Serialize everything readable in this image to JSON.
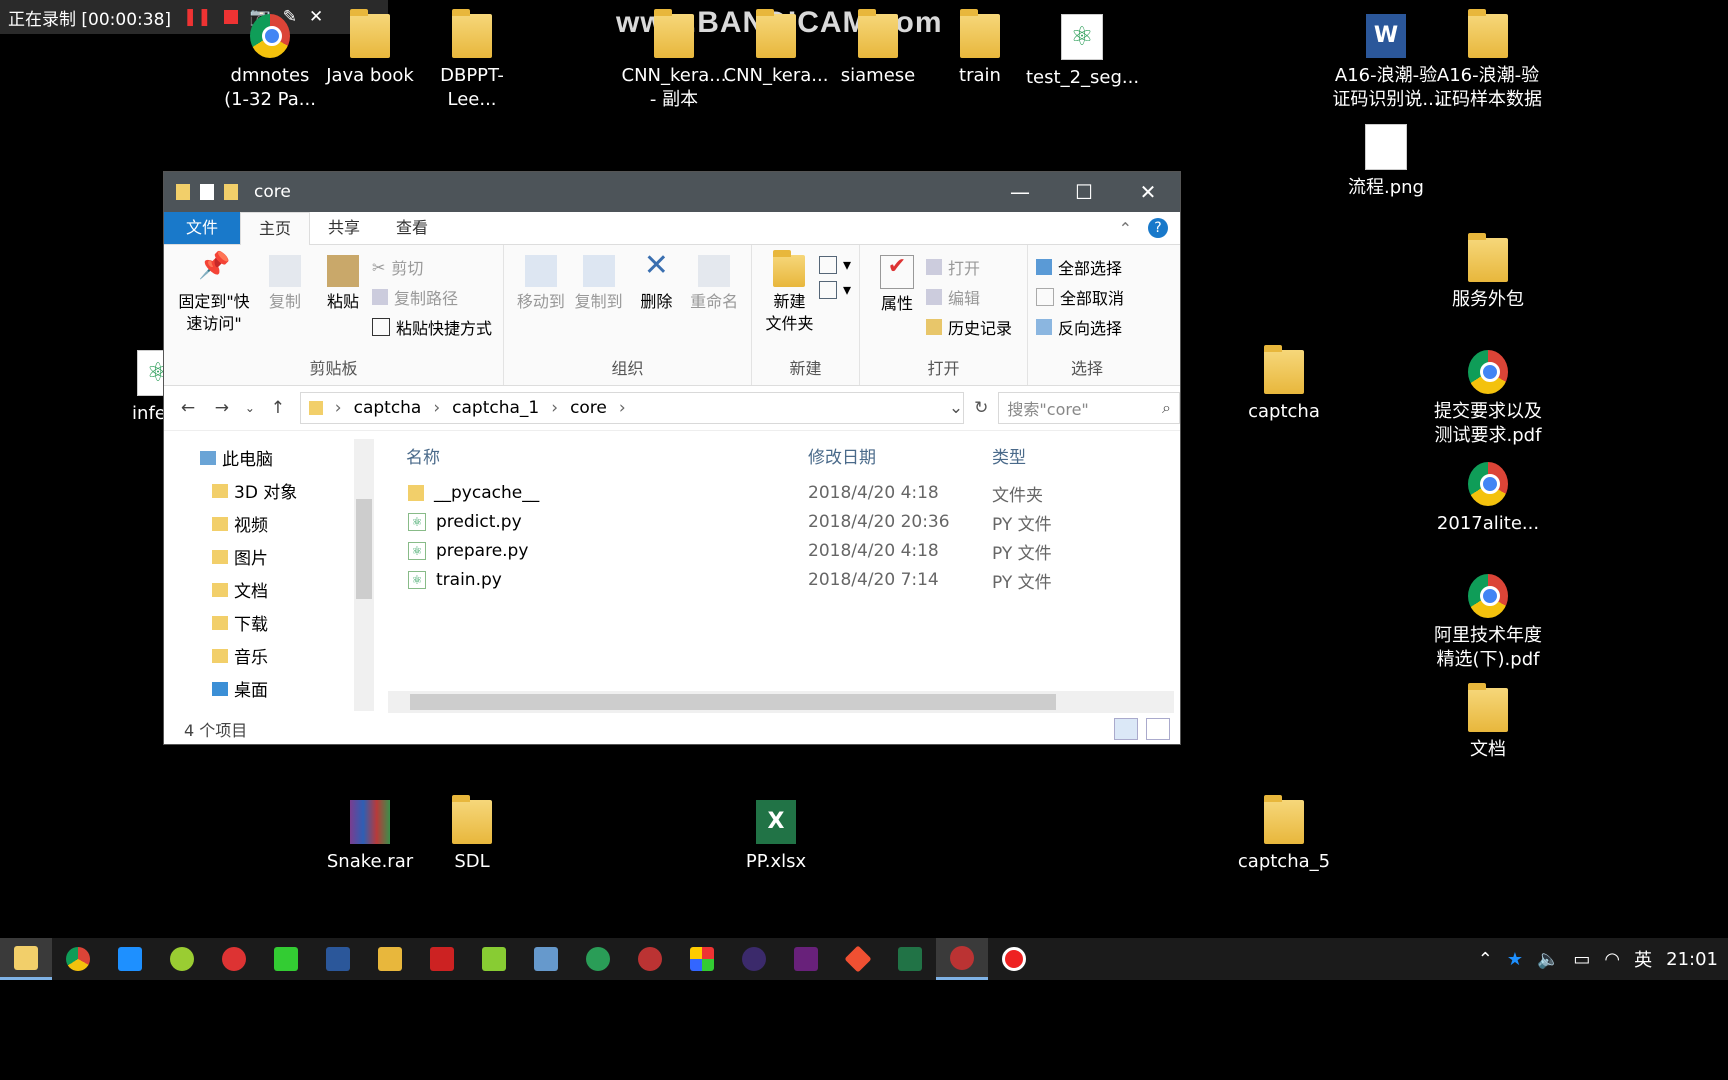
{
  "recorder": {
    "status": "正在录制 [00:00:38]"
  },
  "watermark": "www.BANDICAM.com",
  "desktop_icons": [
    {
      "label": "dmnotes\n(1-32 Pa...",
      "x": "",
      "type": "chrome"
    },
    {
      "label": "Java book"
    },
    {
      "label": "DBPPT-Lee..."
    },
    {
      "label": "CNN_kera...\n- 副本"
    },
    {
      "label": "CNN_kera..."
    },
    {
      "label": "siamese"
    },
    {
      "label": "train"
    },
    {
      "label": "test_2_seg..."
    },
    {
      "label": "A16-浪潮-验\n证码识别说..."
    },
    {
      "label": "A16-浪潮-验\n证码样本数据"
    },
    {
      "label": "流程.png"
    },
    {
      "label": "服务外包"
    },
    {
      "label": "captcha"
    },
    {
      "label": "提交要求以及\n测试要求.pdf"
    },
    {
      "label": "2017alite..."
    },
    {
      "label": "阿里技术年度\n精选(下).pdf"
    },
    {
      "label": "文档"
    },
    {
      "label": "Snake.rar"
    },
    {
      "label": "SDL"
    },
    {
      "label": "PP.xlsx"
    },
    {
      "label": "captcha_5"
    },
    {
      "label": "infere"
    }
  ],
  "explorer": {
    "title": "core",
    "tabs": [
      "文件",
      "主页",
      "共享",
      "查看"
    ],
    "ribbon": {
      "clipboard": {
        "pin": "固定到\"快\n速访问\"",
        "copy": "复制",
        "paste": "粘贴",
        "cut": "剪切",
        "copy_path": "复制路径",
        "paste_shortcut": "粘贴快捷方式",
        "label": "剪贴板"
      },
      "organize": {
        "move": "移动到",
        "copyto": "复制到",
        "delete": "删除",
        "rename": "重命名",
        "label": "组织"
      },
      "new": {
        "new_folder": "新建\n文件夹",
        "label": "新建"
      },
      "open": {
        "properties": "属性",
        "open": "打开",
        "edit": "编辑",
        "history": "历史记录",
        "label": "打开"
      },
      "select": {
        "all": "全部选择",
        "none": "全部取消",
        "invert": "反向选择",
        "label": "选择"
      }
    },
    "path": [
      "captcha",
      "captcha_1",
      "core"
    ],
    "search_placeholder": "搜索\"core\"",
    "nav": [
      "此电脑",
      "3D 对象",
      "视频",
      "图片",
      "文档",
      "下载",
      "音乐",
      "桌面"
    ],
    "columns": {
      "name": "名称",
      "date": "修改日期",
      "type": "类型"
    },
    "files": [
      {
        "name": "__pycache__",
        "date": "2018/4/20 4:18",
        "type": "文件夹",
        "icon": "folder-icon"
      },
      {
        "name": "predict.py",
        "date": "2018/4/20 20:36",
        "type": "PY 文件",
        "icon": "python-file-icon"
      },
      {
        "name": "prepare.py",
        "date": "2018/4/20 4:18",
        "type": "PY 文件",
        "icon": "python-file-icon"
      },
      {
        "name": "train.py",
        "date": "2018/4/20 7:14",
        "type": "PY 文件",
        "icon": "python-file-icon"
      }
    ],
    "status": "4 个项目"
  },
  "taskbar": {
    "time": "21:01",
    "ime": "英"
  }
}
